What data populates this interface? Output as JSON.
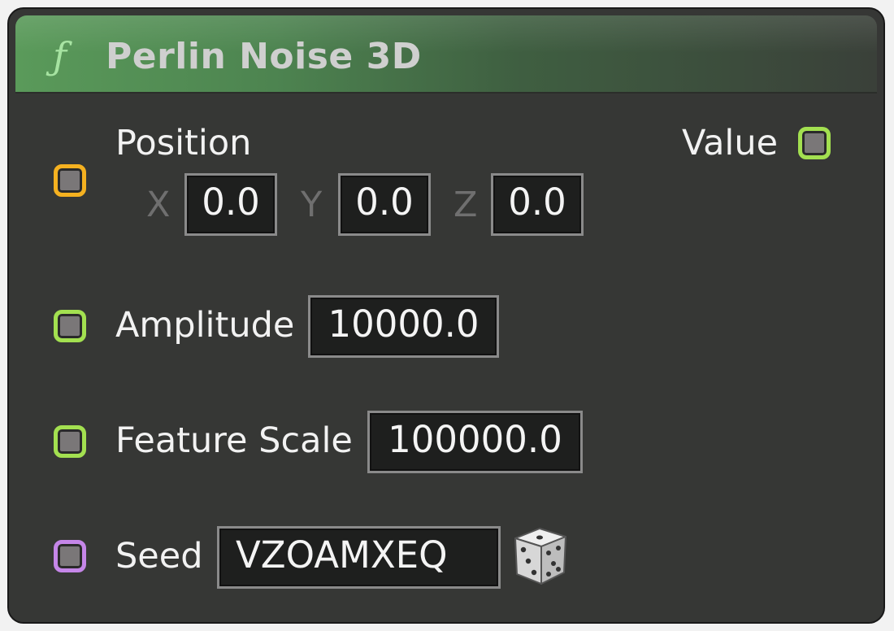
{
  "node": {
    "icon": "function-icon",
    "icon_glyph": "ƒ",
    "title": "Perlin Noise 3D",
    "header_color": "#5a9a5a"
  },
  "inputs": {
    "position": {
      "label": "Position",
      "pin_color": "#f5b120",
      "x_label": "X",
      "x_value": "0.0",
      "y_label": "Y",
      "y_value": "0.0",
      "z_label": "Z",
      "z_value": "0.0"
    },
    "amplitude": {
      "label": "Amplitude",
      "value": "10000.0",
      "pin_color": "#a3e050"
    },
    "feature_scale": {
      "label": "Feature Scale",
      "value": "100000.0",
      "pin_color": "#a3e050"
    },
    "seed": {
      "label": "Seed",
      "value": "VZOAMXEQ",
      "pin_color": "#c586e8",
      "randomize_icon": "dice-icon"
    }
  },
  "outputs": {
    "value": {
      "label": "Value",
      "pin_color": "#a3e050"
    }
  }
}
